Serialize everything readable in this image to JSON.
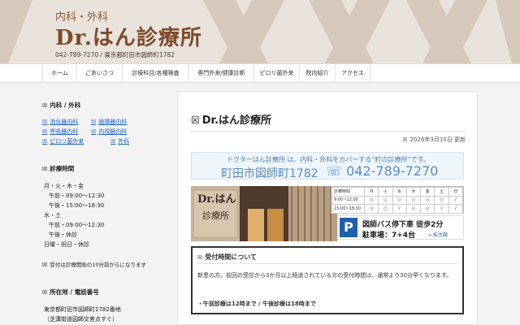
{
  "header": {
    "sub": "内科・外科",
    "title": "Dr.はん診療所",
    "info": "042-789-7270 / 東京都町田市図師町1782"
  },
  "nav": [
    "ホーム",
    "ごあいさつ",
    "診療科目/各種検査",
    "専門外来/健康診断",
    "ピロリ菌外来",
    "院内紹介",
    "アクセス"
  ],
  "sidebar": {
    "dept_heading": "内科 / 外科",
    "dept_links": [
      "消化器内科",
      "循環器内科",
      "呼吸器内科",
      "内視鏡内科",
      "ピロリ菌外来",
      "外科"
    ],
    "hours_heading": "診療時間",
    "hours_lines": [
      "月・火・木・金",
      "午前・09:00〜12:30",
      "午後・15:00〜18:30",
      "水・土",
      "午前・09:00〜12:30",
      "午後・休診",
      "日曜・祝日・休診"
    ],
    "note": "受付は診療開始の10分前からになります",
    "address_heading": "所在地 / 電話番号",
    "address_lines": [
      "東京都町田市図師町1782番地",
      "（芝溝街道図師交差点すぐ）"
    ]
  },
  "main": {
    "page_title": "Dr.はん診療所",
    "updated": "2026年3月10日 更新",
    "banner_line1": "ドクターはん診療所 は、内科・外科をカバーする“町の診療所”です。",
    "banner_city": "町田市図師町1782",
    "banner_tel": "☏ 042-789-7270",
    "photo_sign": "Dr.はん",
    "photo_sign2": "診療所",
    "hours_table": {
      "header_label": "診療時間",
      "days": [
        "月",
        "火",
        "水",
        "木",
        "金",
        "土",
        "日"
      ],
      "rows": [
        {
          "label": "9:00~12:30",
          "marks": [
            "○",
            "○",
            "○",
            "○",
            "○",
            "○",
            "/"
          ]
        },
        {
          "label": "15:00~18:30",
          "marks": [
            "○",
            "○",
            "/",
            "○",
            "○",
            "/",
            "/"
          ]
        }
      ]
    },
    "parking": {
      "p": "P",
      "bus": "図師バス停下車 徒歩2分",
      "lot": "駐車場：7+4台",
      "map_link": "→ 拡大図"
    },
    "notice": {
      "title": "受付時間について",
      "body": "新患の方、前回の受診から3か月以上経過されている方の受付時間は、通常より30分早くなります。",
      "bold": "・午前診療は12時まで / 午後診療は18時まで"
    }
  },
  "colors": {
    "brand": "#7c4a2c",
    "link": "#1a63c7",
    "banner_text": "#5a8cc0",
    "parking_blue": "#1f5fad"
  }
}
